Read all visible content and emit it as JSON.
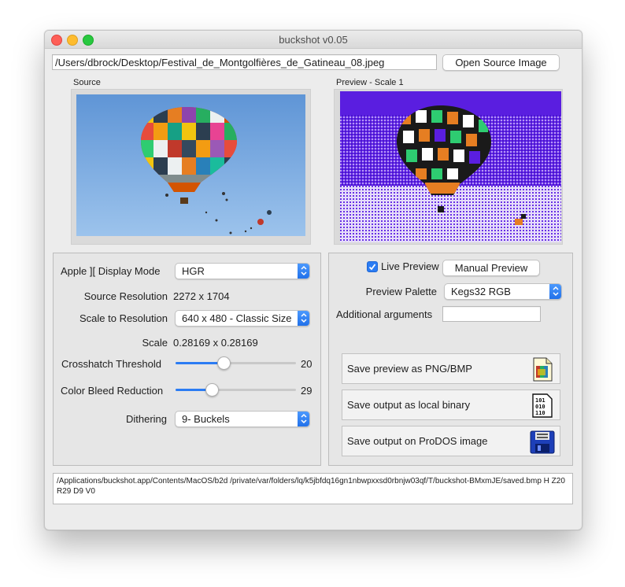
{
  "window": {
    "title": "buckshot  v0.05"
  },
  "file": {
    "path": "/Users/dbrock/Desktop/Festival_de_Montgolfières_de_Gatineau_08.jpeg",
    "open_button": "Open Source Image"
  },
  "images": {
    "source_label": "Source",
    "preview_label": "Preview - Scale 1"
  },
  "settings": {
    "display_mode_label": "Apple ][ Display Mode",
    "display_mode_value": "HGR",
    "source_resolution_label": "Source Resolution",
    "source_resolution_value": "2272 x 1704",
    "scale_to_label": "Scale to Resolution",
    "scale_to_value": "640 x 480 - Classic Size",
    "scale_label": "Scale",
    "scale_value": "0.28169 x 0.28169",
    "crosshatch_label": "Crosshatch Threshold",
    "crosshatch_value": "20",
    "crosshatch_level": 0.4,
    "bleed_label": "Color Bleed Reduction",
    "bleed_value": "29",
    "bleed_level": 0.3,
    "dithering_label": "Dithering",
    "dithering_value": "9- Buckels"
  },
  "preview": {
    "live_preview_label": "Live Preview",
    "live_preview_checked": true,
    "manual_preview_button": "Manual Preview",
    "palette_label": "Preview Palette",
    "palette_value": "Kegs32 RGB",
    "additional_args_label": "Additional arguments",
    "additional_args_value": "",
    "save_png_label": "Save preview as PNG/BMP",
    "save_binary_label": "Save output as local binary",
    "save_prodos_label": "Save output on ProDOS image"
  },
  "command": {
    "text": "/Applications/buckshot.app/Contents/MacOS/b2d /private/var/folders/lq/k5jbfdq16gn1nbwpxxsd0rbnjw03qf/T/buckshot-BMxmJE/saved.bmp H Z20 R29 D9 V0"
  },
  "colors": {
    "accent": "#2b7cf3",
    "preview_bg": "#5a1ee0",
    "sky": "#6fa3dc"
  }
}
